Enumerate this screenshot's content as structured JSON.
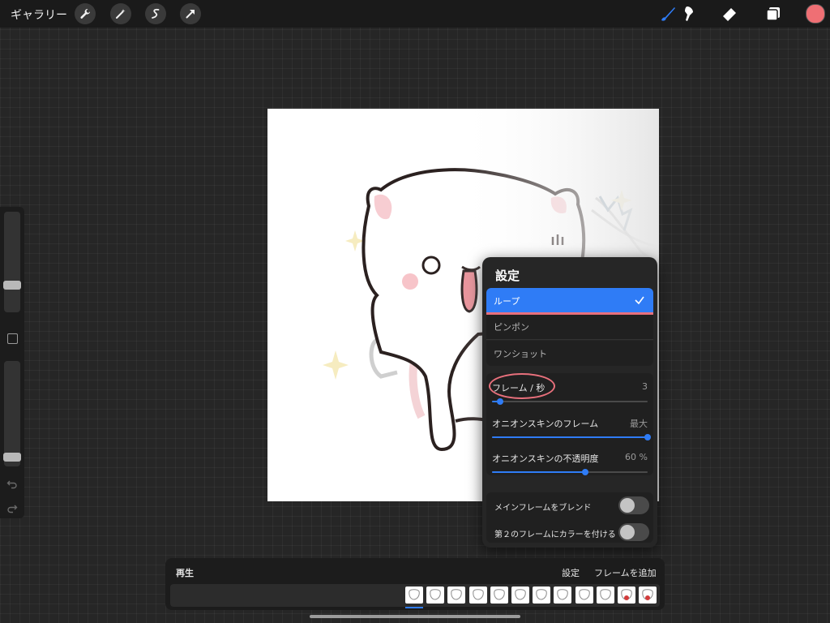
{
  "topbar": {
    "gallery_label": "ギャラリー",
    "left_tools": [
      "wrench-icon",
      "magic-wand-icon",
      "selection-icon",
      "move-arrow-icon"
    ],
    "right_tools": [
      "brush-icon",
      "smudge-icon",
      "eraser-icon",
      "layers-icon"
    ],
    "active_tool": "brush-icon",
    "current_color": "#ef6f74",
    "accent_color": "#2f7cf6"
  },
  "sidebar": {
    "brush_size_level": 0.25,
    "opacity_level": 0.05
  },
  "settings": {
    "title": "設定",
    "modes": [
      {
        "label": "ループ",
        "selected": true
      },
      {
        "label": "ピンポン",
        "selected": false
      },
      {
        "label": "ワンショット",
        "selected": false
      }
    ],
    "fps": {
      "label": "フレーム / 秒",
      "value": "3",
      "level": 0.05
    },
    "onion_frames": {
      "label": "オニオンスキンのフレーム",
      "value": "最大",
      "level": 1.0
    },
    "onion_opacity": {
      "label": "オニオンスキンの不透明度",
      "value": "60 %",
      "level": 0.6
    },
    "blend_main": {
      "label": "メインフレームをブレンド",
      "on": false
    },
    "color_secondary": {
      "label": "第２のフレームにカラーを付ける",
      "on": false
    }
  },
  "timeline": {
    "play_label": "再生",
    "settings_label": "設定",
    "add_frame_label": "フレームを追加",
    "frame_count": 12,
    "selected_frame": 1
  }
}
